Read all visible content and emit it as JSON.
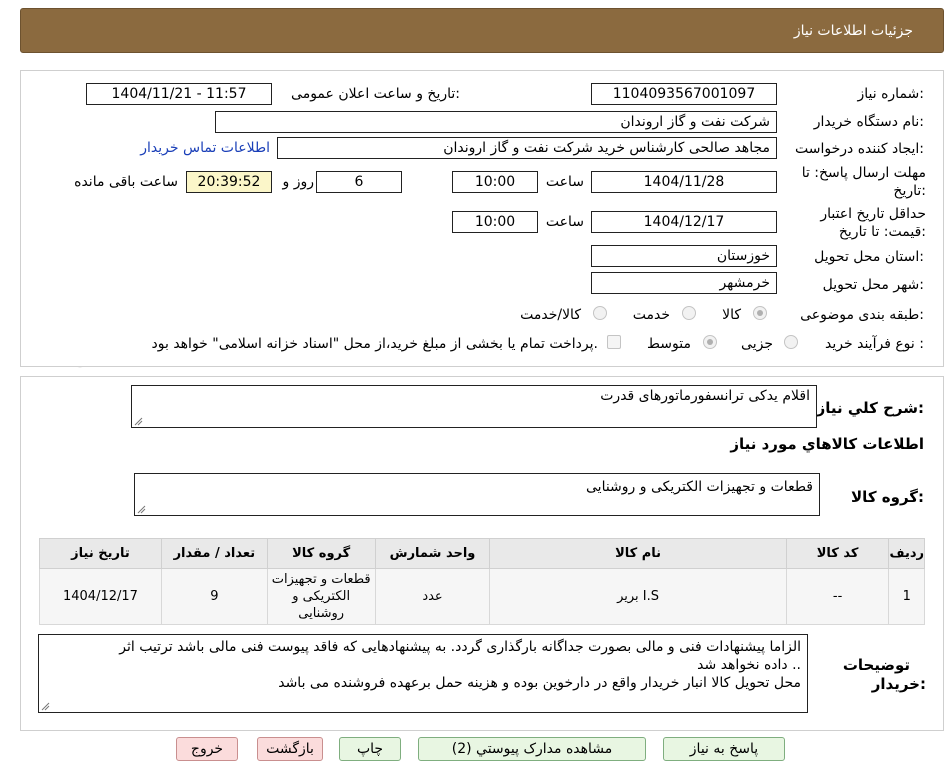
{
  "header": {
    "title": "جزئیات اطلاعات نیاز"
  },
  "watermark": {
    "text": "AriaTender.neT"
  },
  "form": {
    "need_number_label": "شماره نیاز:",
    "need_number": "1104093567001097",
    "announce_label": "تاریخ و ساعت اعلان عمومی:",
    "announce_value": "1404/11/21 - 11:57",
    "buyer_org_label": "نام دستگاه خریدار:",
    "buyer_org": "شرکت نفت و گاز اروندان",
    "requester_label": "ایجاد کننده درخواست:",
    "requester": "مجاهد صالحی کارشناس خرید شرکت نفت و گاز اروندان",
    "contact_link": "اطلاعات تماس خریدار",
    "deadline_label_1": "مهلت ارسال پاسخ: تا",
    "deadline_label_2": "تاریخ:",
    "deadline_date": "1404/11/28",
    "time_label": "ساعت",
    "deadline_time": "10:00",
    "days": "6",
    "day_label": "روز و",
    "remaining_time": "20:39:52",
    "remaining_label": "ساعت باقی مانده",
    "validity_label_1": "حداقل تاریخ اعتبار",
    "validity_label_2": "قیمت: تا تاریخ:",
    "validity_date": "1404/12/17",
    "validity_time": "10:00",
    "province_label": "استان محل تحویل:",
    "province": "خوزستان",
    "city_label": "شهر محل تحویل:",
    "city": "خرمشهر",
    "category_label": "طبقه بندی موضوعی:",
    "category_options": [
      "کالا",
      "خدمت",
      "کالا/خدمت"
    ],
    "process_label": "نوع فرآیند خرید :",
    "process_options": [
      "جزیی",
      "متوسط"
    ],
    "payment_note": "پرداخت تمام یا بخشی از مبلغ خرید،از محل \"اسناد خزانه اسلامی\" خواهد بود."
  },
  "summary": {
    "label": "شرح کلي نياز:",
    "value": "اقلام یدکی ترانسفورماتورهای قدرت",
    "items_heading": "اطلاعات کالاهاي مورد نياز",
    "group_label": "گروه کالا:",
    "group_value": "قطعات و تجهیزات الکتریکی و روشنایی"
  },
  "table": {
    "headers": [
      "رديف",
      "کد کالا",
      "نام کالا",
      "واحد شمارش",
      "گروه کالا",
      "تعداد / مقدار",
      "تاريخ نياز"
    ],
    "rows": [
      [
        "1",
        "--",
        "I.S برير",
        "عدد",
        "قطعات و تجهیزات الکتریکی و روشنایی",
        "9",
        "1404/12/17"
      ]
    ]
  },
  "notes": {
    "label_1": "توضيحات",
    "label_2": "خريدار:",
    "line_1": "الزاما  پیشنهادات فنی و مالی بصورت جداگانه بارگذاری گردد. به پیشنهادهایی که فاقد پیوست فنی مالی باشد ترتیب اثر",
    "line_2": "داده نخواهد شد ..",
    "line_3": "محل تحویل کالا انبار خریدار واقع در  دارخوین بوده و هزینه حمل برعهده فروشنده می باشد"
  },
  "buttons": {
    "reply": "پاسخ به نياز",
    "attachments": "مشاهده مدارک پيوستي (2)",
    "print": "چاپ",
    "back": "بازگشت",
    "exit": "خروج"
  },
  "colors": {
    "header_bg": "#8b6a3f",
    "link": "#1a3fb8",
    "button_bg": "#e8f6e2",
    "danger_bg": "#fbdcdc"
  }
}
